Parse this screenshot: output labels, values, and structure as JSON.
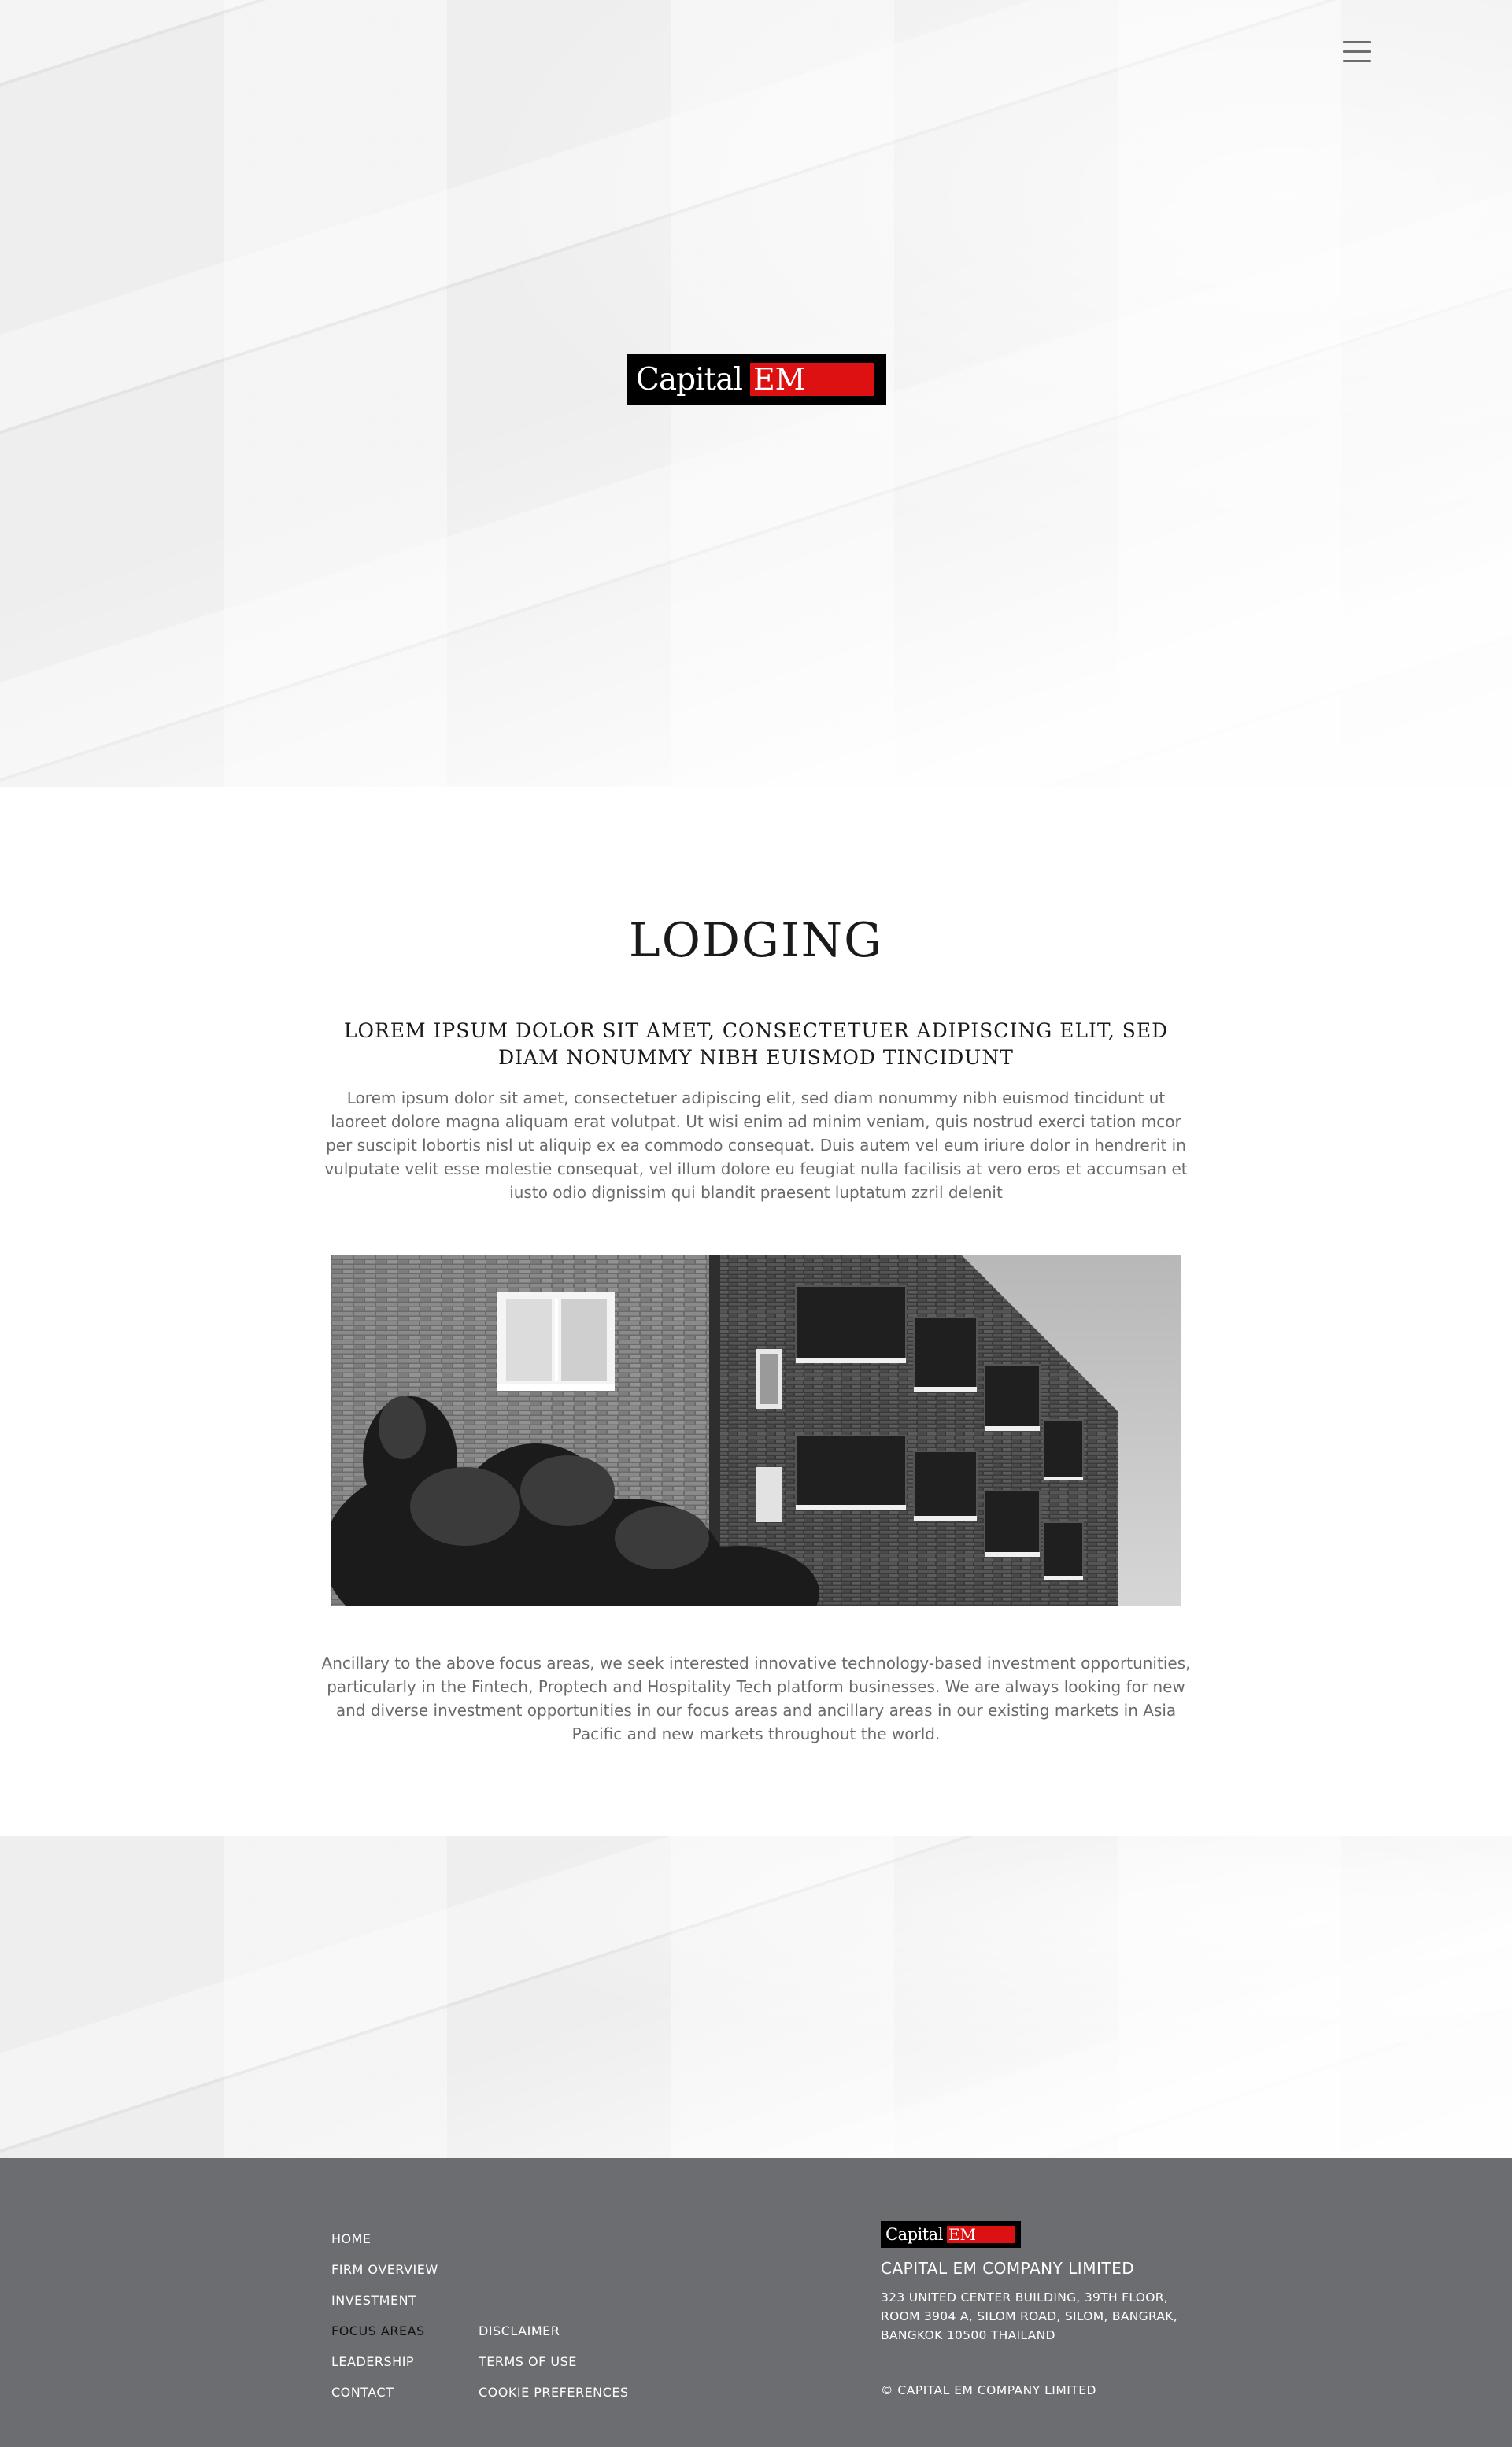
{
  "header": {
    "menu_icon": "hamburger-menu-icon",
    "logo": {
      "word": "Capital",
      "accent": "EM",
      "accent_color": "#dd1111",
      "background": "#000000"
    }
  },
  "main": {
    "title": "LODGING",
    "subheading": "LOREM IPSUM DOLOR SIT AMET, CONSECTETUER ADIPISCING ELIT, SED DIAM NONUMMY NIBH EUISMOD TINCIDUNT",
    "intro": "Lorem ipsum dolor sit amet, consectetuer adipiscing elit, sed diam nonummy nibh euismod tincidunt ut laoreet dolore magna aliquam erat volutpat. Ut wisi enim ad minim veniam, quis nostrud exerci tation mcor per suscipit lobortis nisl ut aliquip ex ea commodo consequat. Duis autem vel eum iriure dolor in hendrerit in vulputate velit esse molestie consequat, vel illum dolore eu feugiat nulla facilisis at vero eros et accumsan et iusto odio dignissim qui blandit praesent luptatum zzril delenit",
    "outro": "Ancillary to the above focus areas, we seek interested innovative technology-based investment opportunities, particularly in the Fintech, Proptech and Hospitality Tech platform businesses. We are always looking for new and diverse investment opportunities in our focus areas and ancillary areas in our existing markets in Asia Pacific and new markets throughout the world."
  },
  "footer": {
    "nav": [
      "HOME",
      "FIRM OVERVIEW",
      "INVESTMENT",
      "FOCUS AREAS",
      "LEADERSHIP",
      "CONTACT"
    ],
    "active_nav": "FOCUS AREAS",
    "legal": [
      "DISCLAIMER",
      "TERMS OF USE",
      "COOKIE PREFERENCES"
    ],
    "logo": {
      "word": "Capital",
      "accent": "EM"
    },
    "company_name": "CAPITAL EM COMPANY LIMITED",
    "address": [
      "323 UNITED CENTER BUILDING, 39TH FLOOR,",
      "ROOM 3904 A, SILOM ROAD, SILOM, BANGRAK,",
      "BANGKOK 10500 THAILAND"
    ],
    "copyright": "© CAPITAL EM COMPANY LIMITED"
  }
}
